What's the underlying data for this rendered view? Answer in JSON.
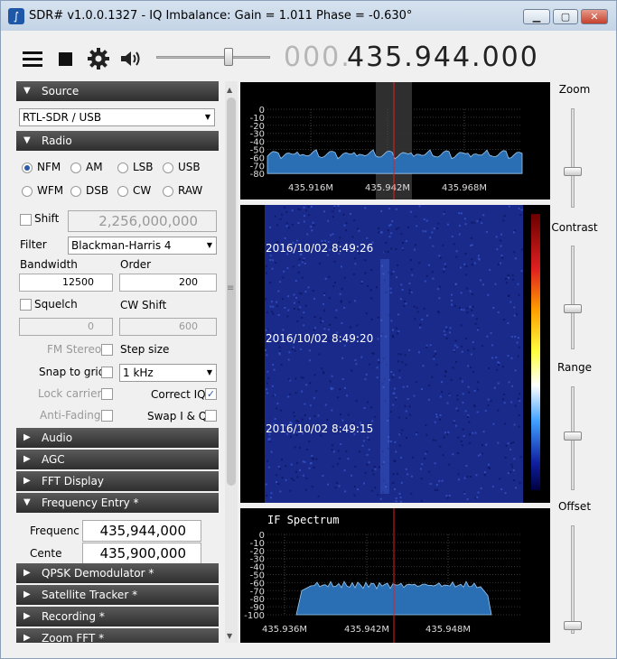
{
  "window": {
    "title": "SDR# v1.0.0.1327 - IQ Imbalance: Gain = 1.011 Phase = -0.630°",
    "minimize": "▁",
    "maximize": "▢",
    "close": "✕"
  },
  "toolbar": {
    "freq_prefix": "000.",
    "freq_main": "435.944.000",
    "volume_level": 0.65
  },
  "source": {
    "header": "Source",
    "device": "RTL-SDR / USB"
  },
  "radio": {
    "header": "Radio",
    "modes": [
      "NFM",
      "AM",
      "LSB",
      "USB",
      "WFM",
      "DSB",
      "CW",
      "RAW"
    ],
    "selected_mode": "NFM",
    "shift_label": "Shift",
    "shift_value": "2,256,000,000",
    "filter_label": "Filter",
    "filter_value": "Blackman-Harris 4",
    "bandwidth_label": "Bandwidth",
    "bandwidth_value": "12500",
    "order_label": "Order",
    "order_value": "200",
    "squelch_label": "Squelch",
    "squelch_value": "0",
    "cwshift_label": "CW Shift",
    "cwshift_value": "600",
    "fmstereo_label": "FM Stereo",
    "stepsize_label": "Step size",
    "snap_label": "Snap to grid",
    "snap_value": "1 kHz",
    "lockcarrier_label": "Lock carrier",
    "correctiq_label": "Correct IQ",
    "antifading_label": "Anti-Fading",
    "swapiq_label": "Swap I & Q"
  },
  "collapsed": {
    "audio": "Audio",
    "agc": "AGC",
    "fft": "FFT Display"
  },
  "freq_entry": {
    "header": "Frequency Entry *",
    "freq_label": "Frequenc",
    "freq_value": "435,944,000",
    "center_label": "Cente",
    "center_value": "435,900,000"
  },
  "plugins": {
    "qpsk": "QPSK Demodulator *",
    "sat": "Satellite Tracker *",
    "rec": "Recording *",
    "zoom": "Zoom FFT *"
  },
  "spectrum": {
    "y_ticks": [
      "0",
      "-10",
      "-20",
      "-30",
      "-40",
      "-50",
      "-60",
      "-70",
      "-80"
    ],
    "x_ticks": [
      "435.916M",
      "435.942M",
      "435.968M"
    ]
  },
  "waterfall": {
    "timestamps": [
      "2016/10/02 8:49:26",
      "2016/10/02 8:49:20",
      "2016/10/02 8:49:15"
    ]
  },
  "if_spectrum": {
    "title": "IF Spectrum",
    "y_ticks": [
      "0",
      "-10",
      "-20",
      "-30",
      "-40",
      "-50",
      "-60",
      "-70",
      "-80",
      "-90",
      "-100"
    ],
    "x_ticks": [
      "435.936M",
      "435.942M",
      "435.948M"
    ]
  },
  "sliders": {
    "zoom": "Zoom",
    "contrast": "Contrast",
    "range": "Range",
    "offset": "Offset"
  },
  "colors": {
    "spectrum_fill": "#2a6fb4",
    "marker": "#e02020",
    "waterfall_bg": "#1a2a8a"
  }
}
